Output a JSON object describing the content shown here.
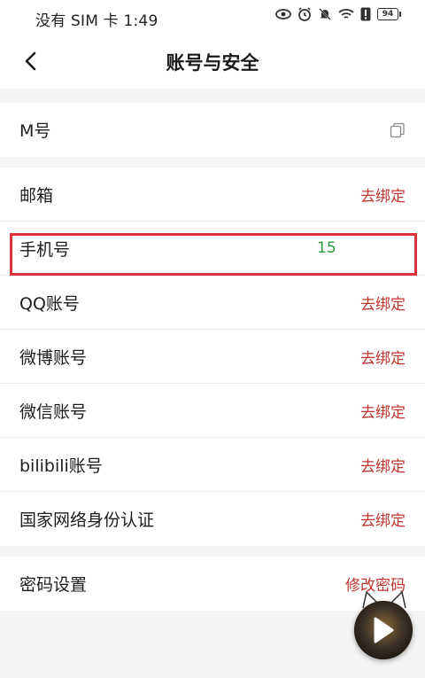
{
  "status_bar": {
    "text": "没有 SIM 卡 1:49",
    "battery": "94"
  },
  "nav": {
    "title": "账号与安全"
  },
  "m_row": {
    "label": "M号"
  },
  "bindings": [
    {
      "label": "邮箱",
      "action": "去绑定"
    },
    {
      "label": "手机号",
      "value": "15"
    },
    {
      "label": "QQ账号",
      "action": "去绑定"
    },
    {
      "label": "微博账号",
      "action": "去绑定"
    },
    {
      "label": "微信账号",
      "action": "去绑定"
    },
    {
      "label": "bilibili账号",
      "action": "去绑定"
    },
    {
      "label": "国家网络身份认证",
      "action": "去绑定"
    }
  ],
  "password": {
    "label": "密码设置",
    "action": "修改密码"
  },
  "colors": {
    "action": "#c0342f",
    "value": "#2e9a3b",
    "highlight": "#d9333a"
  }
}
